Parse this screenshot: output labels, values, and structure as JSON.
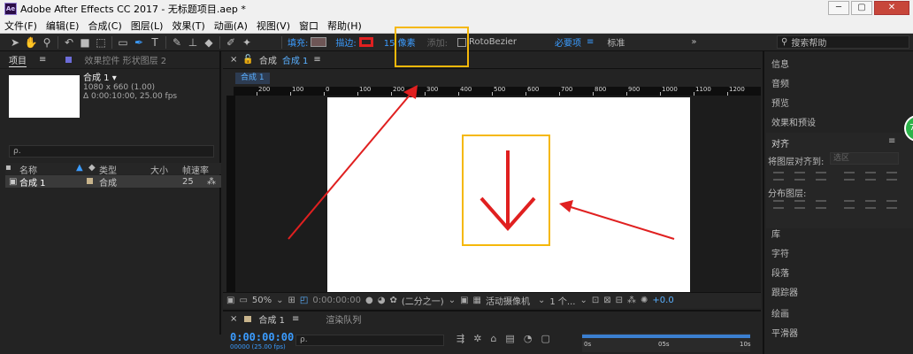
{
  "window": {
    "title": "Adobe After Effects CC 2017 - 无标题项目.aep *",
    "app_icon": "Ae",
    "minimize": "─",
    "maximize": "▢",
    "close": "✕"
  },
  "menubar": {
    "items": [
      "文件(F)",
      "编辑(E)",
      "合成(C)",
      "图层(L)",
      "效果(T)",
      "动画(A)",
      "视图(V)",
      "窗口",
      "帮助(H)"
    ]
  },
  "toolbar": {
    "fill_label": "填充:",
    "stroke_label": "描边:",
    "stroke_width": "15 像素",
    "add_label": "添加:",
    "rotobezier": "RotoBezier",
    "workspace_essentials": "必要项",
    "workspace_standard": "标准",
    "search_help": "搜索帮助",
    "colors": {
      "accent": "#3b9cff",
      "stroke_swatch": "#e02020",
      "fill_swatch": "#6e5656"
    }
  },
  "project_panel": {
    "tab_project": "项目",
    "tab_effects": "效果控件 形状图层 2",
    "comp_name": "合成 1 ▾",
    "comp_size": "1080 x 660 (1.00)",
    "comp_duration": "Δ 0:00:10:00, 25.00 fps",
    "search_placeholder": "ρ.",
    "columns": {
      "name": "名称",
      "type": "类型",
      "size": "大小",
      "fps": "帧速率"
    },
    "rows": [
      {
        "name": "合成 1",
        "type": "合成",
        "size": "",
        "fps": "25"
      }
    ]
  },
  "comp_panel": {
    "tab_label": "合成",
    "tab_name": "合成 1",
    "subtab": "合成 1",
    "ruler_labels": [
      "200",
      "100",
      "0",
      "100",
      "200",
      "300",
      "400",
      "500",
      "600",
      "700",
      "800",
      "900",
      "1000",
      "1100",
      "1200"
    ],
    "zoom": "50%",
    "timecode": "0:00:00:00",
    "resolution": "(二分之一)",
    "camera": "活动摄像机",
    "views": "1 个...",
    "exposure": "+0.0"
  },
  "right_panel": {
    "info": "信息",
    "audio": "音频",
    "preview": "预览",
    "effects_presets": "效果和预设",
    "align": "对齐",
    "align_layers_to": "将图层对齐到:",
    "align_target": "选区",
    "distribute_layers": "分布图层:",
    "library": "库",
    "character": "字符",
    "paragraph": "段落",
    "tracker": "跟踪器",
    "paint": "绘画",
    "smoother": "平滑器"
  },
  "timeline": {
    "tab_comp": "合成 1",
    "tab_render_queue": "渲染队列",
    "timecode": "0:00:00:00",
    "timecode_sub": "00000 (25.00 fps)",
    "search_placeholder": "ρ.",
    "ruler_start": "0s",
    "ruler_mid": "05s",
    "ruler_end": "10s"
  },
  "badge": {
    "text": "74"
  },
  "annotations": {
    "arrow_color": "#e02020",
    "box_color": "#f5b80a"
  }
}
